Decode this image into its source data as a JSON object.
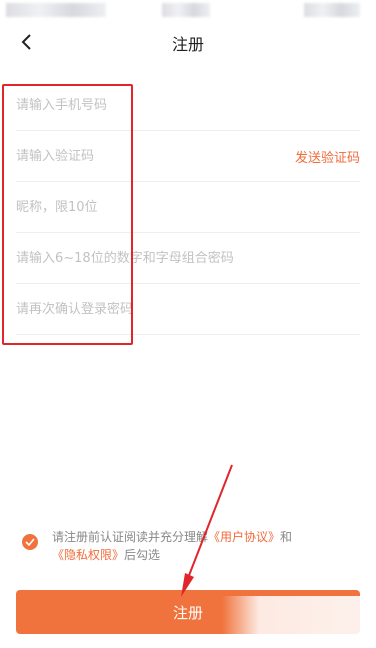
{
  "nav": {
    "title": "注册",
    "back_icon": "chevron-left-icon"
  },
  "form": {
    "phone_placeholder": "请输入手机号码",
    "code_placeholder": "请输入验证码",
    "send_code_label": "发送验证码",
    "nickname_placeholder": "昵称，限10位",
    "password_placeholder": "请输入6~18位的数字和字母组合密码",
    "confirm_password_placeholder": "请再次确认登录密码"
  },
  "agreement": {
    "checked": true,
    "text_prefix": "请注册前认证阅读并充分理解",
    "user_agreement": "《用户协议》",
    "and": "和",
    "privacy": "《隐私权限》",
    "text_suffix": "后勾选"
  },
  "register_button_label": "注册",
  "colors": {
    "accent": "#f0733d",
    "link": "#f26b3a",
    "annotation_red": "#e0262c"
  }
}
